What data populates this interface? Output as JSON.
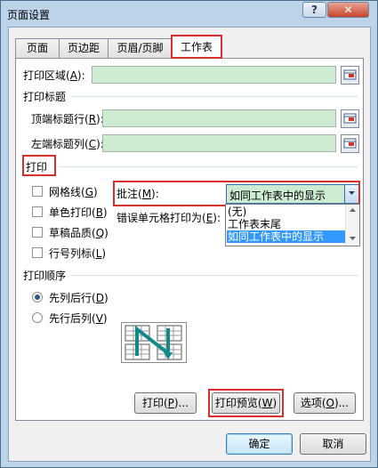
{
  "window": {
    "title": "页面设置",
    "help": "?",
    "close": "✕"
  },
  "tabs": [
    {
      "label": "页面"
    },
    {
      "label": "页边距"
    },
    {
      "label": "页眉/页脚"
    },
    {
      "label": "工作表",
      "active": true
    }
  ],
  "print_area": {
    "label": "打印区域(",
    "key": "A",
    "suffix": "):",
    "value": ""
  },
  "print_titles": {
    "heading": "打印标题",
    "rows": {
      "label": "顶端标题行(",
      "key": "R",
      "suffix": "):",
      "value": ""
    },
    "cols": {
      "label": "左端标题列(",
      "key": "C",
      "suffix": "):",
      "value": ""
    }
  },
  "print_section": {
    "heading": "打印",
    "checkboxes": [
      {
        "label": "网格线(",
        "key": "G",
        "suffix": ")",
        "checked": false
      },
      {
        "label": "单色打印(",
        "key": "B",
        "suffix": ")",
        "checked": false
      },
      {
        "label": "草稿品质(",
        "key": "Q",
        "suffix": ")",
        "checked": false
      },
      {
        "label": "行号列标(",
        "key": "L",
        "suffix": ")",
        "checked": false
      }
    ],
    "comments": {
      "label": "批注(",
      "key": "M",
      "suffix": "):",
      "value": "如同工作表中的显示",
      "options": [
        "(无)",
        "工作表末尾",
        "如同工作表中的显示"
      ],
      "selected_index": 2
    },
    "errors": {
      "label": "错误单元格打印为(",
      "key": "E",
      "suffix": "):"
    }
  },
  "page_order": {
    "heading": "打印顺序",
    "options": [
      {
        "label": "先列后行(",
        "key": "D",
        "suffix": ")",
        "selected": true
      },
      {
        "label": "先行后列(",
        "key": "V",
        "suffix": ")",
        "selected": false
      }
    ]
  },
  "buttons": {
    "print": {
      "label": "打印(",
      "key": "P",
      "suffix": ")..."
    },
    "preview": {
      "label": "打印预览(",
      "key": "W",
      "suffix": ")"
    },
    "options": {
      "label": "选项(",
      "key": "O",
      "suffix": ")..."
    },
    "ok": "确定",
    "cancel": "取消"
  },
  "colors": {
    "highlight_box": "#d9302c",
    "input_fill": "#ccebd1",
    "selection": "#3399ff",
    "titlebar": "#bcd3ea"
  }
}
